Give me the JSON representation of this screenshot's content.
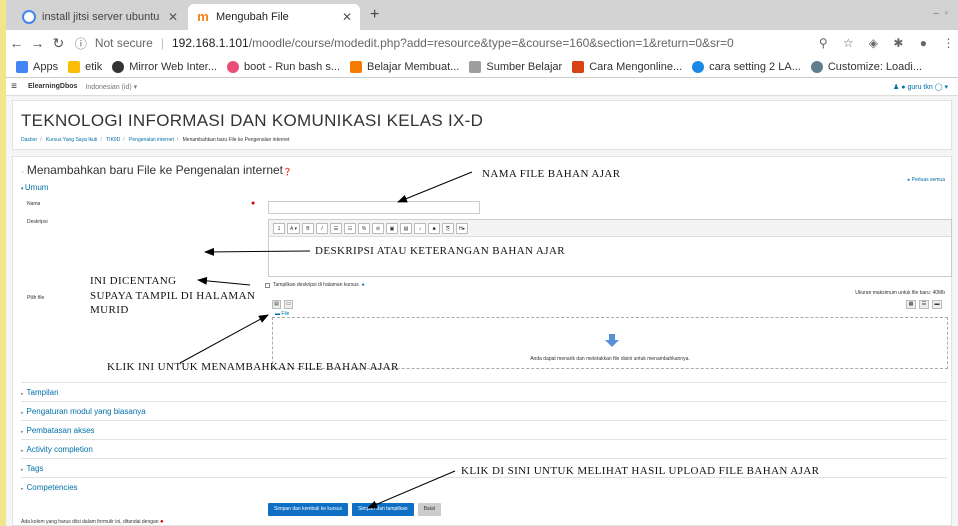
{
  "browser": {
    "tabs": [
      {
        "title": "install jitsi server ubuntu 20.0",
        "active": false
      },
      {
        "title": "Mengubah File",
        "active": true
      }
    ],
    "new_tab": "+",
    "url_security": "Not secure",
    "url_host": "192.168.1.101",
    "url_path": "/moodle/course/modedit.php?add=resource&type=&course=160&section=1&return=0&sr=0",
    "bookmarks": [
      {
        "label": "Apps",
        "color": "#4285f4"
      },
      {
        "label": "etik",
        "color": "#fbbc05"
      },
      {
        "label": "Mirror Web Inter...",
        "color": "#333333"
      },
      {
        "label": "boot - Run bash s...",
        "color": "#e94e77"
      },
      {
        "label": "Belajar Membuat...",
        "color": "#f57c00"
      },
      {
        "label": "Sumber Belajar",
        "color": "#9e9e9e"
      },
      {
        "label": "Cara Mengonline...",
        "color": "#d84315"
      },
      {
        "label": "cara setting 2 LA...",
        "color": "#1e88e5"
      },
      {
        "label": "Customize: Loadi...",
        "color": "#607d8b"
      }
    ]
  },
  "moodle": {
    "site_name": "ElearningDbos",
    "language": "Indonesian (id) ▾",
    "user": "guru tkn",
    "course_title": "TEKNOLOGI INFORMASI DAN KOMUNIKASI KELAS IX-D",
    "breadcrumb": [
      "Dasbor",
      "Kursus Yang Saya Ikuti",
      "TIK9D",
      "Pengenalan internet",
      "Menambahkan baru File ke Pengenalan internet"
    ],
    "form_title": "Menambahkan baru File ke Pengenalan internet",
    "expand_all": "▸ Perluas semua",
    "section_general": "Umum",
    "label_name": "Nama",
    "label_description": "Deskripsi",
    "show_description": "Tampilkan deskripsi di halaman kursus",
    "label_file": "Pilih file",
    "max_size": "Ukuran maksimum untuk file baru: 40Mb",
    "files_path": "File",
    "drop_text": "Anda dapat menarik dan meletakkan file disini untuk menambahkannya.",
    "collapsed_sections": [
      "Tampilan",
      "Pengaturan modul yang biasanya",
      "Pembatasan akses",
      "Activity completion",
      "Tags",
      "Competencies"
    ],
    "btn_save_return": "Simpan dan kembali ke kursus",
    "btn_save_display": "Simpan dan tampilkan",
    "btn_cancel": "Batal",
    "required_note": "Ada kolom yang harus diisi dalam formulir ini, ditandai dengan"
  },
  "annotations": {
    "nama_file": "NAMA FILE BAHAN AJAR",
    "deskripsi": "DESKRIPSI ATAU KETERANGAN BAHAN AJAR",
    "centang_1": "INI DICENTANG",
    "centang_2": "SUPAYA TAMPIL DI HALAMAN",
    "centang_3": "MURID",
    "klik_tambah": "KLIK INI UNTUK MENAMBAHKAN FILE BAHAN AJAR",
    "klik_simpan": "KLIK DI SINI UNTUK MELIHAT HASIL UPLOAD FILE BAHAN AJAR"
  }
}
